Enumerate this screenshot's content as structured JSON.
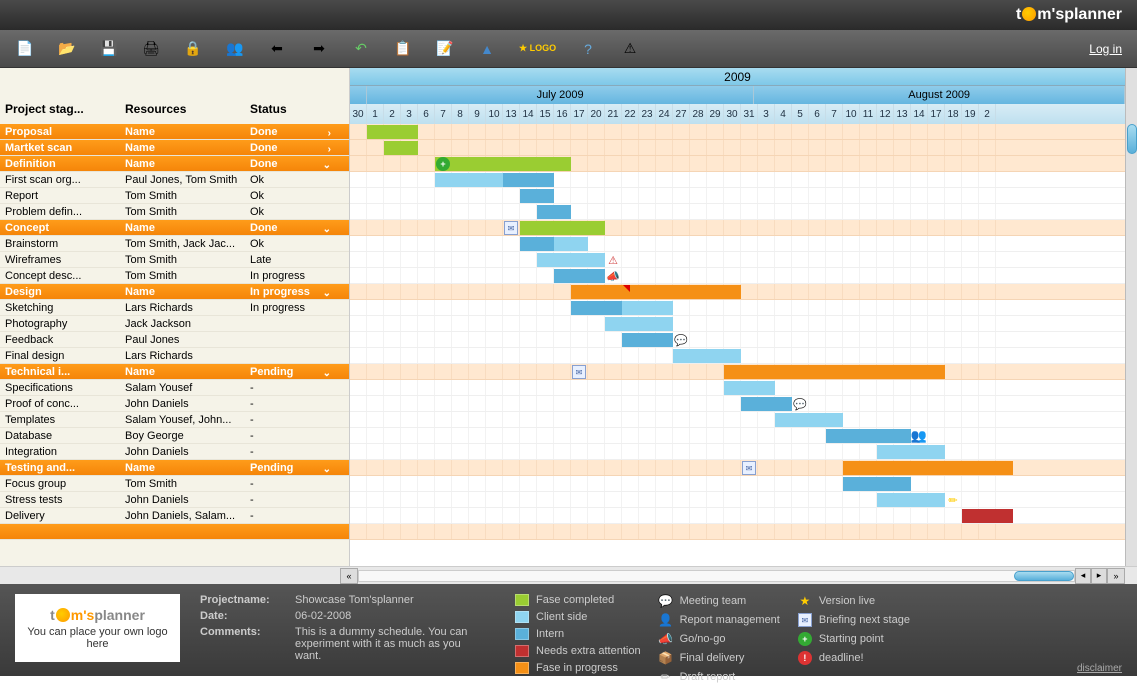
{
  "brand": {
    "pre": "t",
    "post": "m'splanner"
  },
  "login": "Log in",
  "toolbar": {
    "starlogo": "★ LOGO"
  },
  "columns": {
    "stage": "Project stag...",
    "res": "Resources",
    "status": "Status"
  },
  "timeline": {
    "year": "2009",
    "months": [
      {
        "label": "July 2009",
        "span": 23
      },
      {
        "label": "August 2009",
        "span": 22
      }
    ],
    "days": [
      "30",
      "1",
      "2",
      "3",
      "6",
      "7",
      "8",
      "9",
      "10",
      "13",
      "14",
      "15",
      "16",
      "17",
      "20",
      "21",
      "22",
      "23",
      "24",
      "27",
      "28",
      "29",
      "30",
      "31",
      "3",
      "4",
      "5",
      "6",
      "7",
      "10",
      "11",
      "12",
      "13",
      "14",
      "17",
      "18",
      "19",
      "2"
    ]
  },
  "rows": [
    {
      "g": true,
      "stage": "Proposal",
      "res": "Name",
      "status": "Done",
      "chev": "›",
      "bars": [
        {
          "c": "done",
          "s": 1,
          "l": 3
        }
      ]
    },
    {
      "g": true,
      "stage": "Martket scan",
      "res": "Name",
      "status": "Done",
      "chev": "›",
      "bars": [
        {
          "c": "done",
          "s": 2,
          "l": 2
        }
      ]
    },
    {
      "g": true,
      "stage": "Definition",
      "res": "Name",
      "status": "Done",
      "chev": "v",
      "bars": [
        {
          "c": "done",
          "s": 5,
          "l": 8
        }
      ],
      "icons": [
        {
          "t": "green",
          "p": 5,
          "ch": "+"
        }
      ]
    },
    {
      "stage": "First scan org...",
      "res": "Paul Jones, Tom Smith",
      "status": "Ok",
      "bars": [
        {
          "c": "client",
          "s": 5,
          "l": 4
        },
        {
          "c": "intern",
          "s": 9,
          "l": 3
        }
      ]
    },
    {
      "stage": "Report",
      "res": "Tom Smith",
      "status": "Ok",
      "bars": [
        {
          "c": "intern",
          "s": 10,
          "l": 2
        }
      ]
    },
    {
      "stage": "Problem defin...",
      "res": "Tom Smith",
      "status": "Ok",
      "bars": [
        {
          "c": "intern",
          "s": 11,
          "l": 2
        }
      ]
    },
    {
      "g": true,
      "stage": "Concept",
      "res": "Name",
      "status": "Done",
      "chev": "v",
      "bars": [
        {
          "c": "done",
          "s": 10,
          "l": 5
        }
      ],
      "icons": [
        {
          "t": "mail",
          "p": 9,
          "ch": "✉"
        }
      ]
    },
    {
      "stage": "Brainstorm",
      "res": "Tom Smith, Jack Jac...",
      "status": "Ok",
      "bars": [
        {
          "c": "intern",
          "s": 10,
          "l": 2
        },
        {
          "c": "client",
          "s": 12,
          "l": 2
        }
      ]
    },
    {
      "stage": "Wireframes",
      "res": "Tom Smith",
      "status": "Late",
      "bars": [
        {
          "c": "client",
          "s": 11,
          "l": 4
        }
      ],
      "icons": [
        {
          "t": "warn",
          "p": 15,
          "ch": "⚠"
        }
      ]
    },
    {
      "stage": "Concept desc...",
      "res": "Tom Smith",
      "status": "In progress",
      "bars": [
        {
          "c": "intern",
          "s": 12,
          "l": 3
        }
      ],
      "icons": [
        {
          "t": "horn",
          "p": 15,
          "ch": "📣"
        }
      ]
    },
    {
      "g": true,
      "stage": "Design",
      "res": "Name",
      "status": "In progress",
      "chev": "v",
      "bars": [
        {
          "c": "progress",
          "s": 13,
          "l": 10
        }
      ],
      "icons": [
        {
          "t": "rc",
          "p": 16
        }
      ]
    },
    {
      "stage": "Sketching",
      "res": "Lars Richards",
      "status": "In progress",
      "bars": [
        {
          "c": "intern",
          "s": 13,
          "l": 3
        },
        {
          "c": "client",
          "s": 16,
          "l": 3
        }
      ]
    },
    {
      "stage": "Photography",
      "res": "Jack Jackson",
      "status": "",
      "bars": [
        {
          "c": "client",
          "s": 15,
          "l": 4
        }
      ]
    },
    {
      "stage": "Feedback",
      "res": "Paul Jones",
      "status": "",
      "bars": [
        {
          "c": "intern",
          "s": 16,
          "l": 3
        }
      ],
      "icons": [
        {
          "t": "chat",
          "p": 19,
          "ch": "💬"
        }
      ]
    },
    {
      "stage": "Final design",
      "res": "Lars Richards",
      "status": "",
      "bars": [
        {
          "c": "client",
          "s": 19,
          "l": 4
        }
      ]
    },
    {
      "g": true,
      "stage": "Technical i...",
      "res": "Name",
      "status": "Pending",
      "chev": "v",
      "bars": [
        {
          "c": "progress",
          "s": 22,
          "l": 13
        }
      ],
      "icons": [
        {
          "t": "mail",
          "p": 13,
          "ch": "✉"
        }
      ]
    },
    {
      "stage": "Specifications",
      "res": "Salam Yousef",
      "status": "-",
      "bars": [
        {
          "c": "client",
          "s": 22,
          "l": 3
        }
      ]
    },
    {
      "stage": "Proof of conc...",
      "res": "John Daniels",
      "status": "-",
      "bars": [
        {
          "c": "intern",
          "s": 23,
          "l": 3
        }
      ],
      "icons": [
        {
          "t": "chat",
          "p": 26,
          "ch": "💬"
        }
      ]
    },
    {
      "stage": "Templates",
      "res": "Salam Yousef, John...",
      "status": "-",
      "bars": [
        {
          "c": "client",
          "s": 25,
          "l": 4
        }
      ]
    },
    {
      "stage": "Database",
      "res": "Boy George",
      "status": "-",
      "bars": [
        {
          "c": "intern",
          "s": 28,
          "l": 5
        }
      ],
      "icons": [
        {
          "t": "people",
          "p": 33,
          "ch": "👥"
        }
      ]
    },
    {
      "stage": "Integration",
      "res": "John Daniels",
      "status": "-",
      "bars": [
        {
          "c": "client",
          "s": 31,
          "l": 4
        }
      ]
    },
    {
      "g": true,
      "stage": "Testing and...",
      "res": "Name",
      "status": "Pending",
      "chev": "v",
      "bars": [
        {
          "c": "progress",
          "s": 29,
          "l": 10
        }
      ],
      "icons": [
        {
          "t": "mail",
          "p": 23,
          "ch": "✉"
        }
      ]
    },
    {
      "stage": "Focus group",
      "res": "Tom Smith",
      "status": "-",
      "bars": [
        {
          "c": "intern",
          "s": 29,
          "l": 4
        }
      ]
    },
    {
      "stage": "Stress tests",
      "res": "John Daniels",
      "status": "-",
      "bars": [
        {
          "c": "client",
          "s": 31,
          "l": 4
        }
      ],
      "icons": [
        {
          "t": "edit",
          "p": 35,
          "ch": "✏"
        }
      ]
    },
    {
      "stage": "Delivery",
      "res": "John Daniels, Salam...",
      "status": "-",
      "bars": [
        {
          "c": "red",
          "s": 36,
          "l": 3
        }
      ]
    }
  ],
  "footer": {
    "logo_placeholder": "You can place your own logo here",
    "meta": {
      "projectname_l": "Projectname:",
      "projectname": "Showcase Tom'splanner",
      "date_l": "Date:",
      "date": "06-02-2008",
      "comments_l": "Comments:",
      "comments": "This is a dummy schedule. You can experiment with it as much as you want."
    },
    "legend1": [
      {
        "c": "#9acd32",
        "t": "Fase completed"
      },
      {
        "c": "#8fd4f0",
        "t": "Client side"
      },
      {
        "c": "#5ab0da",
        "t": "Intern"
      },
      {
        "c": "#c03030",
        "t": "Needs extra attention"
      },
      {
        "c": "#f59016",
        "t": "Fase in progress"
      }
    ],
    "legend2": [
      {
        "i": "💬",
        "t": "Meeting team"
      },
      {
        "i": "👤",
        "t": "Report management"
      },
      {
        "i": "📣",
        "t": "Go/no-go"
      },
      {
        "i": "📦",
        "t": "Final delivery"
      },
      {
        "i": "✏",
        "t": "Draft report"
      }
    ],
    "legend3": [
      {
        "i": "★",
        "cls": "ic-star",
        "t": "Version live"
      },
      {
        "i": "✉",
        "cls": "ic-mail",
        "t": "Briefing next stage"
      },
      {
        "i": "+",
        "cls": "ic-green",
        "t": "Starting point"
      },
      {
        "i": "!",
        "cls": "ic-red",
        "t": "deadline!"
      }
    ],
    "disclaimer": "disclaimer"
  }
}
